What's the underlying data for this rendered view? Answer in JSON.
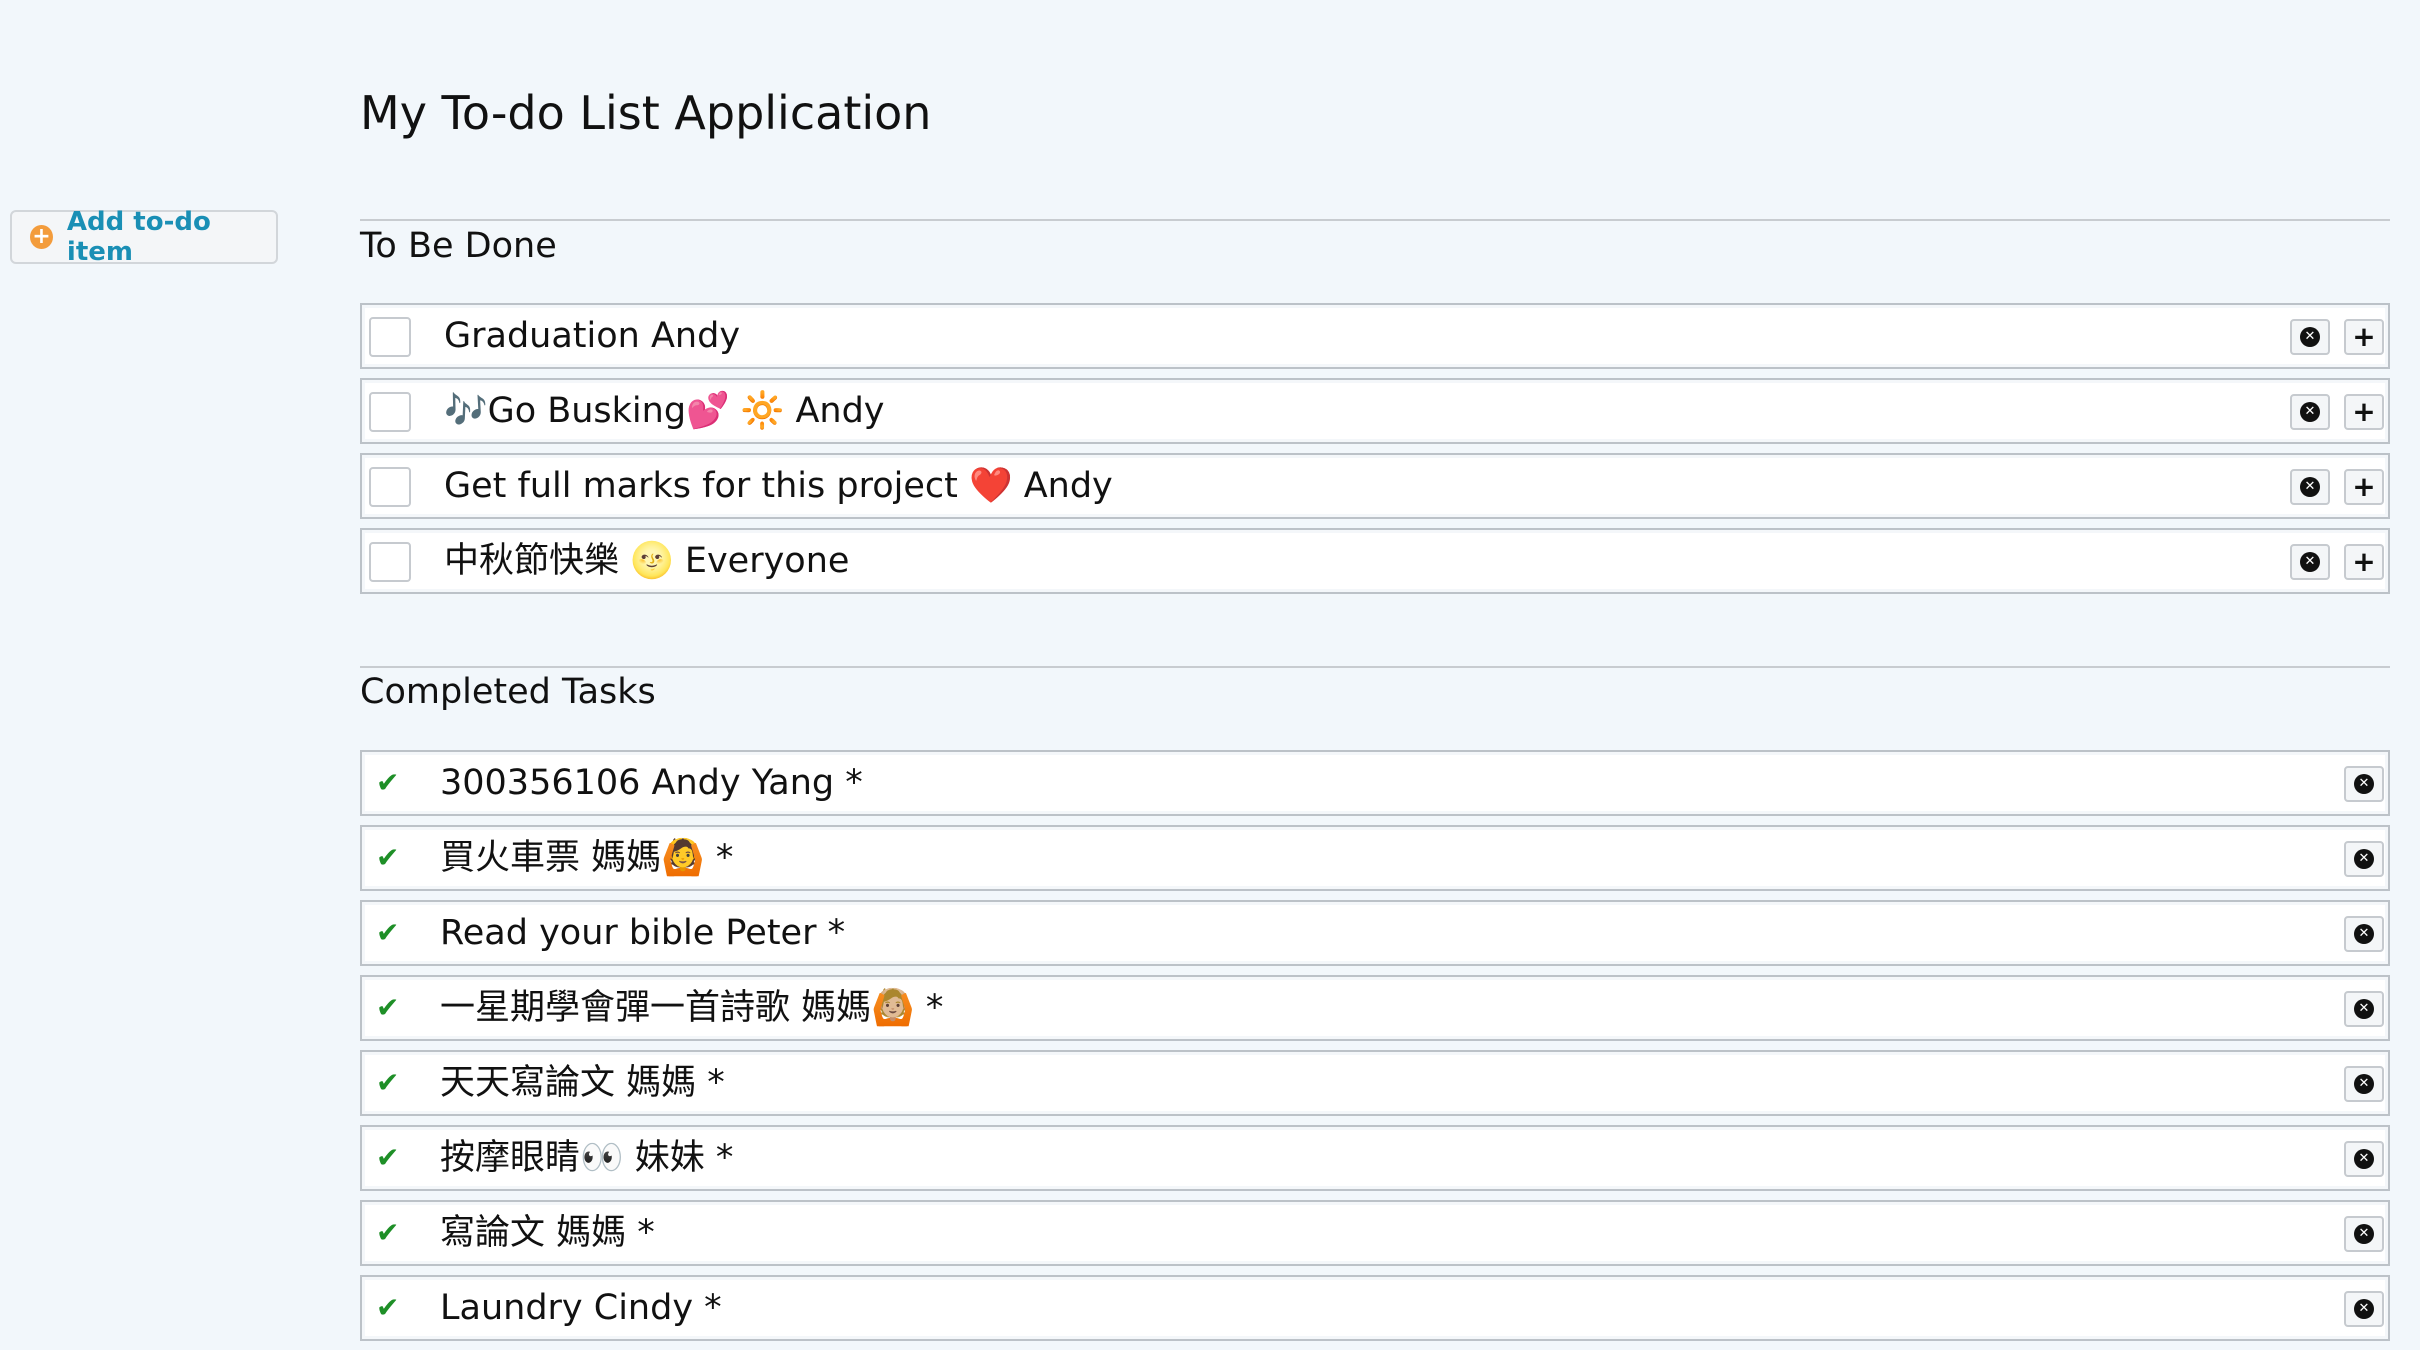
{
  "app": {
    "title": "My To-do List Application"
  },
  "sidebar": {
    "add_button_label": "Add to-do item"
  },
  "sections": {
    "todo": {
      "title": "To Be Done",
      "items": [
        {
          "text": "Graduation Andy"
        },
        {
          "text": "🎶Go Busking💕 🔆 Andy"
        },
        {
          "text": "Get full marks for this project ❤️ Andy"
        },
        {
          "text": "中秋節快樂 🌝 Everyone"
        }
      ]
    },
    "completed": {
      "title": "Completed Tasks",
      "items": [
        {
          "text": "300356106 Andy Yang *"
        },
        {
          "text": "買火車票 媽媽🙆 *"
        },
        {
          "text": "Read your bible Peter *"
        },
        {
          "text": "一星期學會彈一首詩歌 媽媽🙆🏼 *"
        },
        {
          "text": "天天寫論文 媽媽 *"
        },
        {
          "text": "按摩眼睛👀 妹妹 *"
        },
        {
          "text": "寫論文 媽媽 *"
        },
        {
          "text": "Laundry Cindy *"
        }
      ]
    }
  },
  "icons": {
    "add": "plus-circle-icon",
    "delete": "close-circle-icon",
    "expand": "plus-icon",
    "done": "checkmark-icon"
  },
  "colors": {
    "background": "#f2f7fb",
    "link": "#1a8fb5",
    "add_icon": "#f39c3c",
    "check": "#1e8f27"
  }
}
